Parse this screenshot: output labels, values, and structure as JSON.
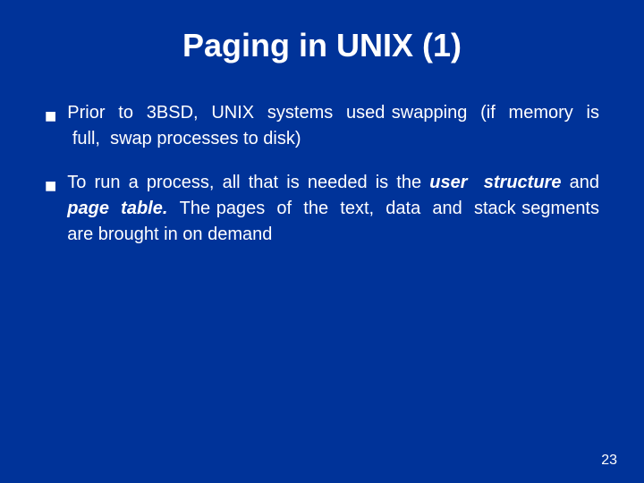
{
  "title": "Paging in UNIX (1)",
  "bullets": [
    {
      "id": "bullet1",
      "text_parts": [
        {
          "text": "Prior  to  3BSD,  UNIX  systems  used swapping  (if  memory  is  full,  swap processes to disk)",
          "italic": false
        }
      ]
    },
    {
      "id": "bullet2",
      "text_parts": [
        {
          "text": "To run a process, all that is needed is the ",
          "italic": false
        },
        {
          "text": "user  structure",
          "italic": true
        },
        {
          "text": " and ",
          "italic": false
        },
        {
          "text": "page  table.",
          "italic": true
        },
        {
          "text": "  The pages  of  the  text,  data  and  stack segments are brought in on demand",
          "italic": false
        }
      ]
    }
  ],
  "slide_number": "23"
}
